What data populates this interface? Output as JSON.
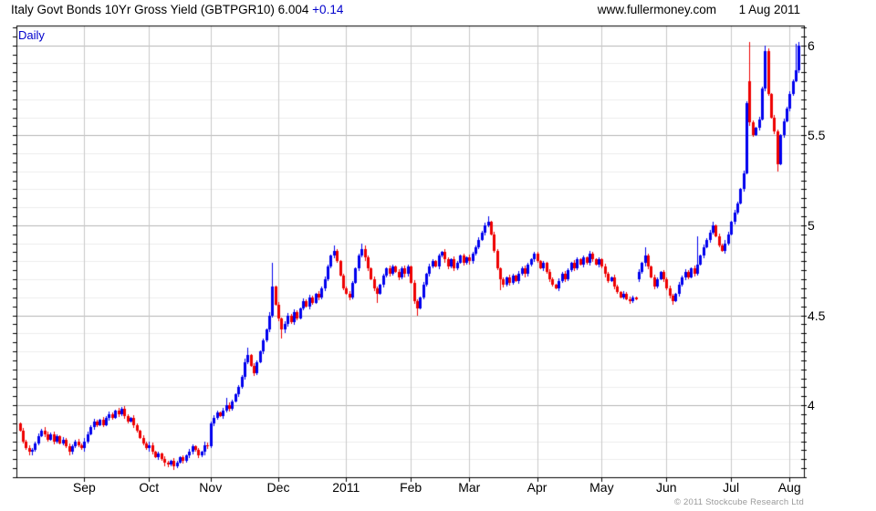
{
  "header": {
    "title_main": "Italy Govt Bonds 10Yr Gross Yield (GBTPGR10) 6.004",
    "title_change": "+0.14",
    "site": "www.fullermoney.com",
    "date": "1 Aug 2011"
  },
  "chart_label": "Daily",
  "footer": {
    "copyright": "© 2011 Stockcube Research Ltd"
  },
  "chart_data": {
    "type": "candlestick",
    "title": "Italy Govt Bonds 10Yr Gross Yield (GBTPGR10)",
    "frequency": "Daily",
    "last_price": 6.004,
    "change": "+0.14",
    "y_axis": {
      "min": 3.6,
      "max": 6.11,
      "major_ticks": [
        6,
        5.5,
        5,
        4.5,
        4
      ],
      "major_labels": [
        "6",
        "5.5",
        "5",
        "4.5",
        "4"
      ],
      "minor_step": 0.1,
      "tick_step": 0.05,
      "grid": true
    },
    "x_axis": {
      "count": 254,
      "months": [
        {
          "label": "Sep",
          "index": 21
        },
        {
          "label": "Oct",
          "index": 42
        },
        {
          "label": "Nov",
          "index": 62
        },
        {
          "label": "Dec",
          "index": 84
        },
        {
          "label": "2011",
          "index": 106
        },
        {
          "label": "Feb",
          "index": 127
        },
        {
          "label": "Mar",
          "index": 146
        },
        {
          "label": "Apr",
          "index": 168
        },
        {
          "label": "May",
          "index": 189
        },
        {
          "label": "Jun",
          "index": 210
        },
        {
          "label": "Jul",
          "index": 231
        },
        {
          "label": "Aug",
          "index": 250
        }
      ]
    },
    "colors": {
      "up": "#0000ee",
      "down": "#ee0000",
      "grid_major": "#b5b5b5",
      "grid_minor": "#ececec",
      "grid_month": "#c9c9c9",
      "border": "#000000"
    },
    "closes": [
      3.86,
      3.8,
      3.76,
      3.74,
      3.75,
      3.79,
      3.83,
      3.86,
      3.84,
      3.81,
      3.84,
      3.8,
      3.83,
      3.79,
      3.81,
      3.77,
      3.74,
      3.77,
      3.8,
      3.78,
      3.76,
      3.8,
      3.84,
      3.88,
      3.91,
      3.89,
      3.92,
      3.89,
      3.93,
      3.95,
      3.93,
      3.97,
      3.95,
      3.98,
      3.94,
      3.91,
      3.93,
      3.89,
      3.86,
      3.82,
      3.79,
      3.76,
      3.78,
      3.74,
      3.71,
      3.73,
      3.7,
      3.68,
      3.67,
      3.69,
      3.66,
      3.68,
      3.71,
      3.69,
      3.72,
      3.74,
      3.77,
      3.75,
      3.72,
      3.74,
      3.78,
      3.77,
      3.9,
      3.93,
      3.96,
      3.94,
      3.97,
      4.0,
      3.98,
      4.02,
      4.06,
      4.1,
      4.16,
      4.24,
      4.28,
      4.22,
      4.18,
      4.24,
      4.3,
      4.36,
      4.42,
      4.5,
      4.66,
      4.56,
      4.48,
      4.42,
      4.45,
      4.5,
      4.46,
      4.52,
      4.48,
      4.54,
      4.58,
      4.55,
      4.6,
      4.57,
      4.62,
      4.6,
      4.65,
      4.7,
      4.77,
      4.83,
      4.86,
      4.8,
      4.72,
      4.65,
      4.62,
      4.6,
      4.68,
      4.76,
      4.83,
      4.87,
      4.82,
      4.76,
      4.7,
      4.65,
      4.62,
      4.67,
      4.72,
      4.76,
      4.73,
      4.77,
      4.74,
      4.71,
      4.76,
      4.73,
      4.77,
      4.68,
      4.58,
      4.54,
      4.6,
      4.67,
      4.73,
      4.77,
      4.8,
      4.77,
      4.83,
      4.85,
      4.81,
      4.77,
      4.81,
      4.76,
      4.79,
      4.83,
      4.79,
      4.82,
      4.8,
      4.84,
      4.88,
      4.92,
      4.96,
      5.0,
      5.02,
      4.95,
      4.86,
      4.76,
      4.7,
      4.67,
      4.71,
      4.68,
      4.72,
      4.69,
      4.73,
      4.76,
      4.73,
      4.78,
      4.81,
      4.84,
      4.8,
      4.76,
      4.79,
      4.74,
      4.7,
      4.67,
      4.65,
      4.69,
      4.73,
      4.7,
      4.75,
      4.79,
      4.76,
      4.81,
      4.78,
      4.82,
      4.79,
      4.84,
      4.81,
      4.78,
      4.81,
      4.77,
      4.73,
      4.69,
      4.71,
      4.66,
      4.63,
      4.6,
      4.62,
      4.59,
      4.58,
      4.6,
      4.59,
      4.74,
      4.79,
      4.83,
      4.77,
      4.71,
      4.66,
      4.7,
      4.74,
      4.7,
      4.65,
      4.61,
      4.58,
      4.62,
      4.67,
      4.71,
      4.74,
      4.71,
      4.76,
      4.73,
      4.78,
      4.83,
      4.88,
      4.92,
      4.96,
      5.0,
      4.94,
      4.89,
      4.86,
      4.9,
      4.95,
      5.02,
      5.07,
      5.12,
      5.2,
      5.29,
      5.68,
      5.57,
      5.5,
      5.54,
      5.59,
      5.76,
      5.97,
      5.73,
      5.6,
      5.52,
      5.34,
      5.5,
      5.58,
      5.65,
      5.73,
      5.8,
      5.86,
      6.0
    ],
    "overrides": {
      "opens": {
        "0": 3.9,
        "201": 4.7,
        "237": 5.8
      },
      "highs": {
        "67": 4.04,
        "74": 4.32,
        "82": 4.79,
        "102": 4.89,
        "111": 4.9,
        "152": 5.05,
        "203": 4.88,
        "220": 4.94,
        "225": 5.02,
        "237": 6.02,
        "242": 6.0,
        "252": 6.01,
        "253": 6.02
      },
      "lows": {
        "4": 3.72,
        "50": 3.64,
        "85": 4.37,
        "116": 4.57,
        "129": 4.5,
        "156": 4.64,
        "212": 4.56,
        "246": 5.3
      }
    }
  }
}
